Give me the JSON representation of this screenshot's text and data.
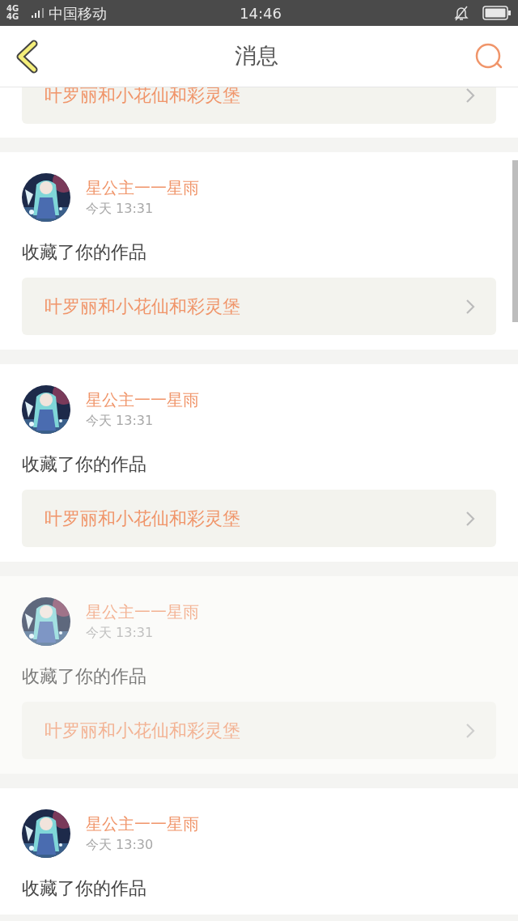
{
  "status_bar": {
    "network": "4G 4G",
    "carrier": "中国移动",
    "time": "14:46"
  },
  "header": {
    "title": "消息"
  },
  "messages": [
    {
      "kind": "partial",
      "link": "叶罗丽和小花仙和彩灵堡",
      "faded": false
    },
    {
      "kind": "full",
      "name": "星公主一一星雨",
      "time": "今天 13:31",
      "action": "收藏了你的作品",
      "link": "叶罗丽和小花仙和彩灵堡",
      "faded": false
    },
    {
      "kind": "full",
      "name": "星公主一一星雨",
      "time": "今天 13:31",
      "action": "收藏了你的作品",
      "link": "叶罗丽和小花仙和彩灵堡",
      "faded": false
    },
    {
      "kind": "full",
      "name": "星公主一一星雨",
      "time": "今天 13:31",
      "action": "收藏了你的作品",
      "link": "叶罗丽和小花仙和彩灵堡",
      "faded": true
    },
    {
      "kind": "full",
      "name": "星公主一一星雨",
      "time": "今天 13:30",
      "action": "收藏了你的作品",
      "faded": false
    }
  ]
}
